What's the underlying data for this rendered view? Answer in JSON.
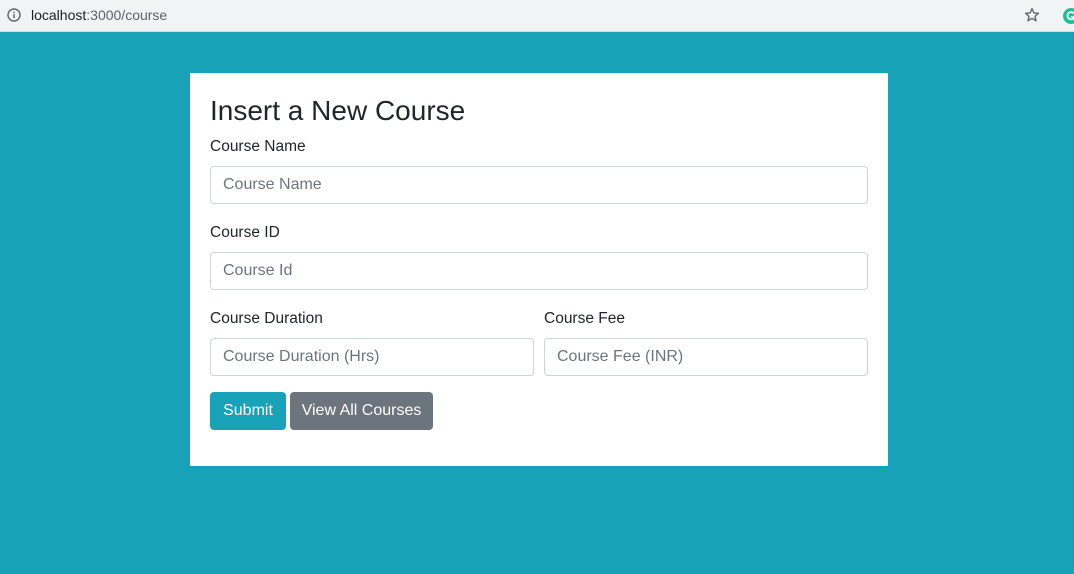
{
  "browser": {
    "url_host": "localhost",
    "url_path": ":3000/course"
  },
  "form": {
    "title": "Insert a New Course",
    "course_name": {
      "label": "Course Name",
      "placeholder": "Course Name",
      "value": ""
    },
    "course_id": {
      "label": "Course ID",
      "placeholder": "Course Id",
      "value": ""
    },
    "course_duration": {
      "label": "Course Duration",
      "placeholder": "Course Duration (Hrs)",
      "value": ""
    },
    "course_fee": {
      "label": "Course Fee",
      "placeholder": "Course Fee (INR)",
      "value": ""
    },
    "submit_label": "Submit",
    "view_all_label": "View All Courses"
  },
  "icons": {
    "address_bar": "info-icon",
    "bookmark": "star-icon",
    "extension": "grammarly-icon"
  },
  "colors": {
    "page_background": "#17a2b8",
    "submit_button": "#17a2b8",
    "secondary_button": "#6c757d",
    "extension_icon": "#15c39a"
  }
}
